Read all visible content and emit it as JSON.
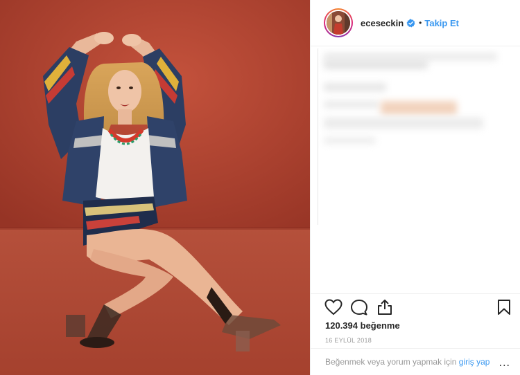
{
  "post": {
    "username": "eceseckin",
    "follow_label": "Takip Et",
    "dot": "•",
    "likes_count": "120.394",
    "likes_word": "beğenme",
    "date": "16 EYLÜL 2018",
    "login_prompt": "Beğenmek veya yorum yapmak için",
    "login_link": "giriş yap",
    "more_label": "..."
  },
  "icons": {
    "verified": "verified-badge-icon",
    "like": "heart-icon",
    "comment": "comment-bubble-icon",
    "share": "share-icon",
    "save": "bookmark-icon"
  },
  "colors": {
    "link": "#3897f0",
    "background_photo": "#a7402f"
  }
}
